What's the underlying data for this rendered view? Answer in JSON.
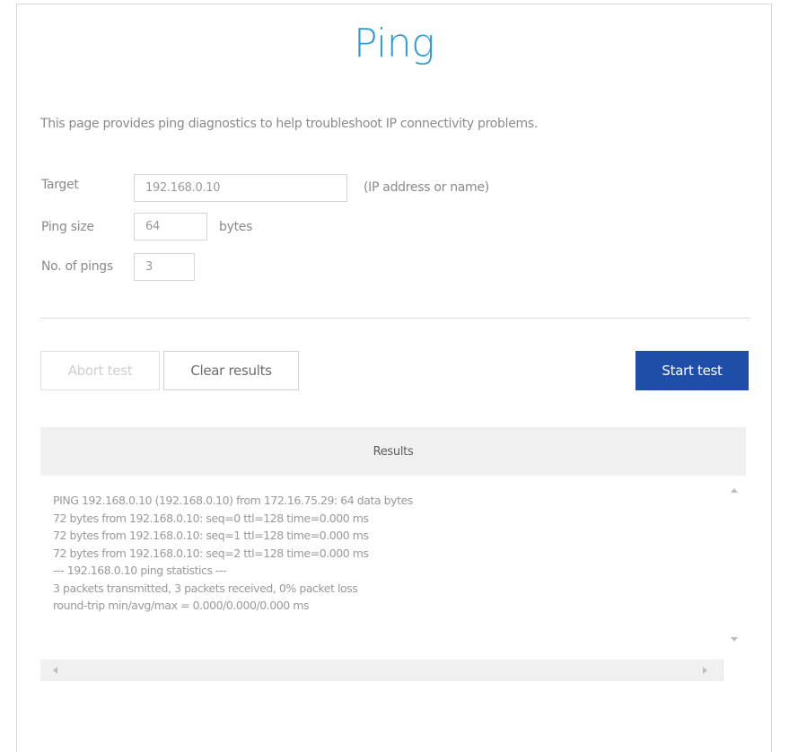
{
  "page": {
    "title": "Ping",
    "description": "This page provides ping diagnostics to help troubleshoot IP connectivity problems."
  },
  "form": {
    "target": {
      "label": "Target",
      "value": "192.168.0.10",
      "hint": "(IP address or name)"
    },
    "ping_size": {
      "label": "Ping size",
      "value": "64",
      "unit": "bytes"
    },
    "ping_count": {
      "label": "No. of pings",
      "value": "3"
    }
  },
  "actions": {
    "abort_label": "Abort test",
    "abort_enabled": false,
    "clear_label": "Clear results",
    "start_label": "Start test"
  },
  "results": {
    "header": "Results",
    "lines": [
      "PING 192.168.0.10 (192.168.0.10) from 172.16.75.29: 64 data bytes",
      "72 bytes from 192.168.0.10: seq=0 ttl=128 time=0.000 ms",
      "72 bytes from 192.168.0.10: seq=1 ttl=128 time=0.000 ms",
      "72 bytes from 192.168.0.10: seq=2 ttl=128 time=0.000 ms",
      "--- 192.168.0.10 ping statistics ---",
      "3 packets transmitted, 3 packets received, 0% packet loss",
      "round-trip min/avg/max = 0.000/0.000/0.000 ms"
    ]
  },
  "icons": {
    "scroll_up": "scroll-up-arrow-icon",
    "scroll_down": "scroll-down-arrow-icon",
    "scroll_left": "scroll-left-arrow-icon",
    "scroll_right": "scroll-right-arrow-icon"
  },
  "colors": {
    "title": "#2a9bd6",
    "primary_button": "#1f4ea8",
    "text": "#8a8a8a",
    "disabled_text": "#cfcfcf"
  }
}
